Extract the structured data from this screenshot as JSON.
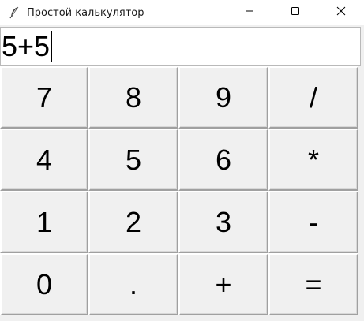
{
  "window": {
    "title": "Простой калькулятор"
  },
  "icons": {
    "app": "feather-icon",
    "minimize": "minimize-icon",
    "maximize": "maximize-icon",
    "close": "close-icon"
  },
  "display": {
    "value": "5+5"
  },
  "keys": [
    {
      "label": "7",
      "name": "key-7"
    },
    {
      "label": "8",
      "name": "key-8"
    },
    {
      "label": "9",
      "name": "key-9"
    },
    {
      "label": "/",
      "name": "key-divide"
    },
    {
      "label": "4",
      "name": "key-4"
    },
    {
      "label": "5",
      "name": "key-5"
    },
    {
      "label": "6",
      "name": "key-6"
    },
    {
      "label": "*",
      "name": "key-multiply"
    },
    {
      "label": "1",
      "name": "key-1"
    },
    {
      "label": "2",
      "name": "key-2"
    },
    {
      "label": "3",
      "name": "key-3"
    },
    {
      "label": "-",
      "name": "key-subtract"
    },
    {
      "label": "0",
      "name": "key-0"
    },
    {
      "label": ".",
      "name": "key-decimal"
    },
    {
      "label": "+",
      "name": "key-add"
    },
    {
      "label": "=",
      "name": "key-equals"
    }
  ],
  "colors": {
    "window_bg": "#f0f0f0",
    "titlebar_bg": "#ffffff",
    "entry_bg": "#ffffff",
    "text": "#000000"
  }
}
